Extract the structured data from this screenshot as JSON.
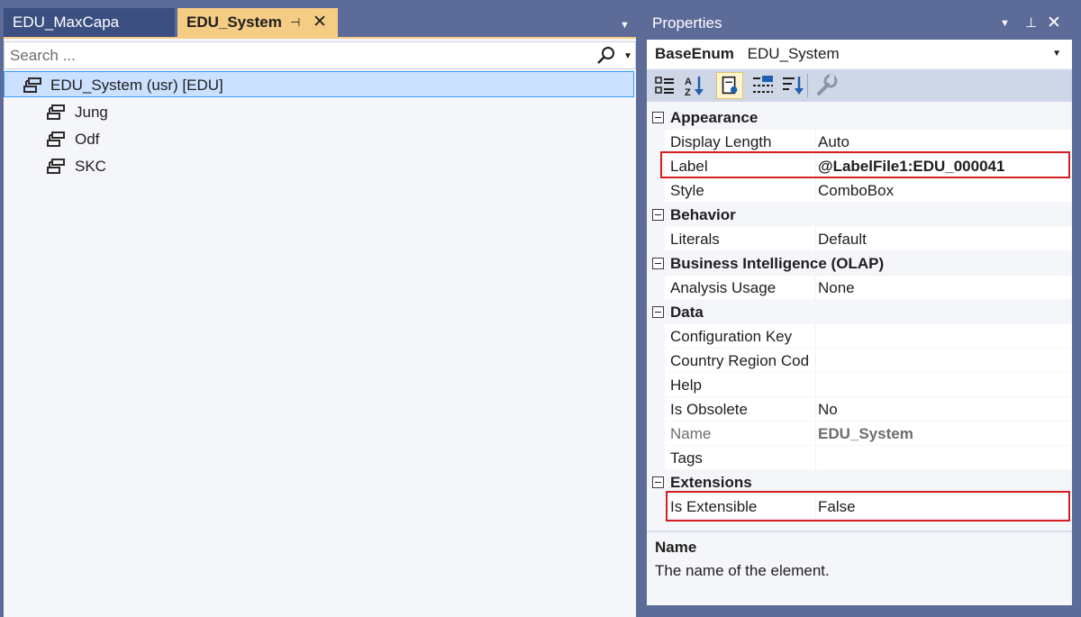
{
  "document_tabs": [
    {
      "label": "EDU_MaxCapa",
      "active": false
    },
    {
      "label": "EDU_System",
      "active": true
    }
  ],
  "tab_icons": {
    "pin": "pin-icon",
    "close": "close-icon",
    "dropdown": "chevron-down-icon"
  },
  "search": {
    "placeholder": "Search ...",
    "value": ""
  },
  "tree": {
    "root": {
      "label": "EDU_System (usr) [EDU]",
      "icon": "enum-icon"
    },
    "children": [
      {
        "label": "Jung",
        "icon": "enum-value-icon"
      },
      {
        "label": "Odf",
        "icon": "enum-value-icon"
      },
      {
        "label": "SKC",
        "icon": "enum-value-icon"
      }
    ]
  },
  "properties_panel": {
    "title": "Properties",
    "object_type": "BaseEnum",
    "object_name": "EDU_System",
    "toolbar": [
      "categorized-icon",
      "alphabetical-icon",
      "properties-icon",
      "events-icon",
      "sort-icon",
      "settings-icon"
    ],
    "categories": [
      {
        "label": "Appearance",
        "props": [
          {
            "name": "Display Length",
            "value": "Auto"
          },
          {
            "name": "Label",
            "value": "@LabelFile1:EDU_000041",
            "bold": true,
            "highlighted": true
          },
          {
            "name": "Style",
            "value": "ComboBox"
          }
        ]
      },
      {
        "label": "Behavior",
        "props": [
          {
            "name": "Literals",
            "value": "Default"
          }
        ]
      },
      {
        "label": "Business Intelligence (OLAP)",
        "props": [
          {
            "name": "Analysis Usage",
            "value": "None"
          }
        ]
      },
      {
        "label": "Data",
        "props": [
          {
            "name": "Configuration Key",
            "value": ""
          },
          {
            "name": "Country Region Cod",
            "value": ""
          },
          {
            "name": "Help",
            "value": ""
          },
          {
            "name": "Is Obsolete",
            "value": "No"
          },
          {
            "name": "Name",
            "value": "EDU_System",
            "bold": true,
            "readonly": true
          },
          {
            "name": "Tags",
            "value": ""
          }
        ]
      },
      {
        "label": "Extensions",
        "props": [
          {
            "name": "Is Extensible",
            "value": "False",
            "highlighted": true
          }
        ]
      }
    ],
    "description": {
      "title": "Name",
      "text": "The name of the element."
    }
  },
  "colors": {
    "highlight_box": "#d51f1f",
    "active_tab": "#f5cc84",
    "selection": "#cce0ff",
    "chrome": "#5d6b99"
  }
}
